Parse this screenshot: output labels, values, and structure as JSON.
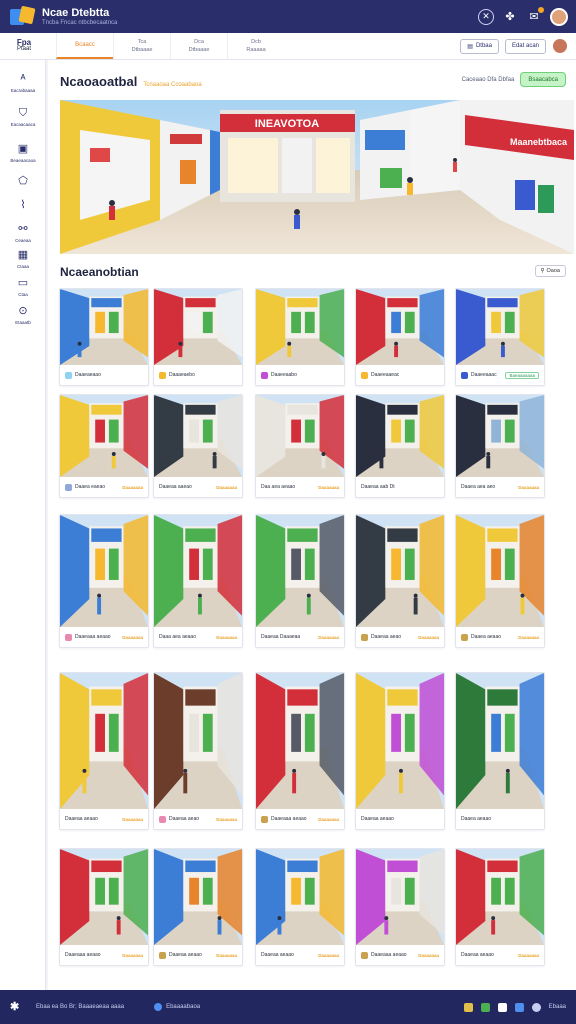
{
  "app": {
    "title": "Ncae Dtebtta",
    "subtitle": "Tncba Fncac ntbcbecaatnca"
  },
  "topbar": {
    "icons": [
      "x-icon",
      "puzzle-icon",
      "chat-icon",
      "user-avatar"
    ]
  },
  "nav": {
    "brand_top": "Fpa",
    "brand_bottom": "Ptaat",
    "tabs": [
      {
        "top": "Bcaacc",
        "bottom": "",
        "active": true
      },
      {
        "top": "Tca",
        "bottom": "Dtbaaae",
        "active": false
      },
      {
        "top": "Dca",
        "bottom": "Dtbaaae",
        "active": false
      },
      {
        "top": "Dcb",
        "bottom": "Raaaaa",
        "active": false
      }
    ],
    "btn1": "Dtbaa",
    "btn2": "Edat acan"
  },
  "sidebar": {
    "items": [
      {
        "icon": "home-icon",
        "label": "Eacrabaaaa"
      },
      {
        "icon": "shield-icon",
        "label": "Eacaacaaca"
      },
      {
        "icon": "document-icon",
        "label": "Beaeaacaoa"
      },
      {
        "icon": "tag-icon",
        "label": ""
      },
      {
        "icon": "chart-icon",
        "label": ""
      },
      {
        "icon": "people-icon",
        "label": "Ceaeaa"
      },
      {
        "icon": "calendar-icon",
        "label": "Ctaaa"
      },
      {
        "icon": "folder-icon",
        "label": "Ctaa"
      },
      {
        "icon": "settings-icon",
        "label": "Etaaatb"
      }
    ]
  },
  "hero": {
    "title": "Ncaoaoatbal",
    "subtitle": "Tcnaaoaa Ccoaabaoa",
    "meta": "Caceaao   Dfa Dbfaa",
    "badge": "Bsaacabca",
    "storefront_sign": "INEAVOTOA",
    "right_sign": "Maanebtbaca"
  },
  "section": {
    "title": "Ncaeanobtian",
    "button": "Oaoa"
  },
  "cards": [
    {
      "name": "Daaeaeaao",
      "price": "",
      "tag": "",
      "icon_color": "#8fd3f0"
    },
    {
      "name": "Daaaeaebo",
      "price": "",
      "tag": "",
      "icon_color": "#f5b82e"
    },
    {
      "name": "Daaeeaabo",
      "price": "",
      "tag": "",
      "icon_color": "#c04fd6"
    },
    {
      "name": "Daaeeaaeac",
      "price": "",
      "tag": "",
      "icon_color": "#f5b82e"
    },
    {
      "name": "Daaeeaaac",
      "price": "",
      "tag": "Baeaaaaaaa",
      "icon_color": "#3a5ad0"
    },
    {
      "name": "Daaea eaeao",
      "price": "Daaaaaaa",
      "tag": "",
      "icon_color": "#8fa8d8"
    },
    {
      "name": "Daaeaa aaeao",
      "price": "Daaaaaaa",
      "tag": "",
      "icon_color": ""
    },
    {
      "name": "Daa aea aeaao",
      "price": "Daaaaaaa",
      "tag": "",
      "icon_color": ""
    },
    {
      "name": "Daaeaa aab Dt",
      "price": "",
      "tag": "",
      "icon_color": ""
    },
    {
      "name": "Daaea aea aeo",
      "price": "Daaaaaaa",
      "tag": "",
      "icon_color": ""
    },
    {
      "name": "Daaeaaa aeaao",
      "price": "Daaaaaaa",
      "tag": "",
      "icon_color": "#e88ab0"
    },
    {
      "name": "Daaa aea aeaao",
      "price": "Daaaaaaa",
      "tag": "",
      "icon_color": ""
    },
    {
      "name": "Daaeaa Daaaeaa",
      "price": "Daaaaaaa",
      "tag": "",
      "icon_color": ""
    },
    {
      "name": "Daaeaa aeao",
      "price": "Daaaaaaa",
      "tag": "",
      "icon_color": "#c8a24f"
    },
    {
      "name": "Daaea aeaao",
      "price": "Daaaaaaa",
      "tag": "",
      "icon_color": "#c8a24f"
    },
    {
      "name": "Daaeaa aeaao",
      "price": "Daaaaaaa",
      "tag": "",
      "icon_color": ""
    },
    {
      "name": "Daaeaa aeao",
      "price": "Daaaaaaa",
      "tag": "",
      "icon_color": "#e88ab0"
    },
    {
      "name": "Daaeaaa aeaao",
      "price": "Daaaaaaa",
      "tag": "",
      "icon_color": "#c8a24f"
    },
    {
      "name": "Daaeaa aeaao",
      "price": "",
      "tag": "",
      "icon_color": ""
    },
    {
      "name": "Daaea aeaao",
      "price": "",
      "tag": "",
      "icon_color": ""
    },
    {
      "name": "Daaeaaa aeaao",
      "price": "Daaaaaaa",
      "tag": "",
      "icon_color": ""
    },
    {
      "name": "Daaeaa aeaao",
      "price": "Daaaaaaa",
      "tag": "",
      "icon_color": "#c8a24f"
    },
    {
      "name": "Daaeaa aeaao",
      "price": "Daaaaaaa",
      "tag": "",
      "icon_color": ""
    },
    {
      "name": "Daaeaaa aeaao",
      "price": "Daaaaaaa",
      "tag": "",
      "icon_color": "#c8a24f"
    },
    {
      "name": "Daaeaa aeaao",
      "price": "Daaaaaaa",
      "tag": "",
      "icon_color": ""
    }
  ],
  "footer": {
    "text": "Ebaa ea Bo Br; Baaaeaeaa aaaa",
    "link": "Ebaaaabaoa",
    "right": "Ebaaa"
  },
  "colors": {
    "topbar": "#2a2f6b",
    "accent": "#e8842a",
    "badge_green": "#c6f2c8",
    "footer": "#222760"
  }
}
